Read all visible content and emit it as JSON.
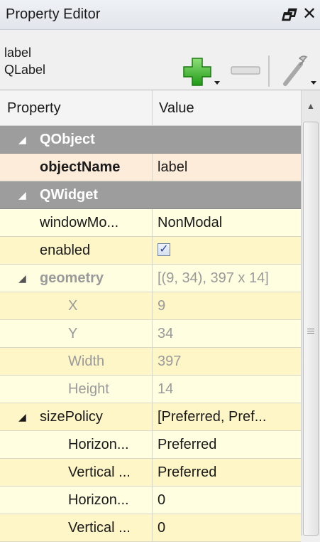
{
  "window": {
    "title": "Property Editor",
    "float_glyph": "🗗",
    "close_glyph": "✕"
  },
  "object": {
    "name": "label",
    "class_name": "QLabel"
  },
  "toolbar": {
    "add_icon": "add-dynamic-property-icon",
    "remove_icon": "remove-dynamic-property-icon",
    "config_icon": "configure-wrench-icon"
  },
  "table": {
    "headers": {
      "property": "Property",
      "value": "Value"
    },
    "rows": [
      {
        "name": "QObject",
        "value": ""
      },
      {
        "name": "objectName",
        "value": "label"
      },
      {
        "name": "QWidget",
        "value": ""
      },
      {
        "name": "windowMo...",
        "value": "NonModal"
      },
      {
        "name": "enabled",
        "value": "✓",
        "checked": true
      },
      {
        "name": "geometry",
        "value": "[(9, 34), 397 x 14]"
      },
      {
        "name": "X",
        "value": "9"
      },
      {
        "name": "Y",
        "value": "34"
      },
      {
        "name": "Width",
        "value": "397"
      },
      {
        "name": "Height",
        "value": "14"
      },
      {
        "name": "sizePolicy",
        "value": "[Preferred, Pref..."
      },
      {
        "name": "Horizon...",
        "value": "Preferred"
      },
      {
        "name": "Vertical ...",
        "value": "Preferred"
      },
      {
        "name": "Horizon...",
        "value": "0"
      },
      {
        "name": "Vertical ...",
        "value": "0"
      }
    ]
  },
  "icons": {
    "expand_arrow": "◢"
  },
  "colors": {
    "category_bg": "#9d9d9d",
    "row_selected": "#fdecd9",
    "row_yellow": "#fffee0",
    "add_green": "#3bb82a"
  }
}
